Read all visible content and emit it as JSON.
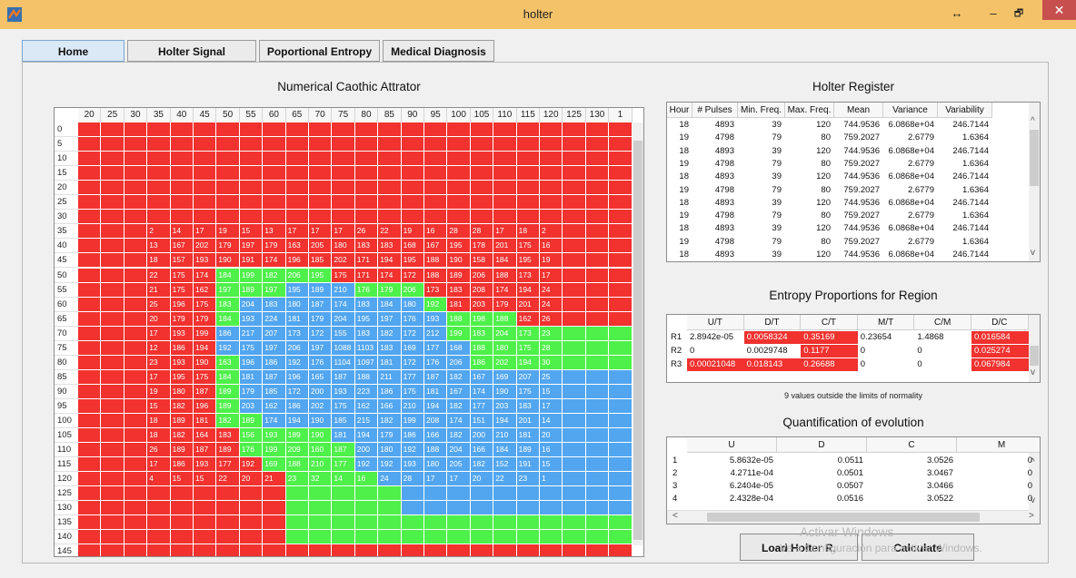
{
  "window": {
    "title": "holter",
    "buttons": {
      "restore": "↔",
      "minimize": "–",
      "maximize": "🗗",
      "close": "✕"
    },
    "accent": "#f3c269"
  },
  "tabs": [
    {
      "label": "Home",
      "active": true
    },
    {
      "label": "Holter Signal",
      "active": false
    },
    {
      "label": "Poportional Entropy",
      "active": false
    },
    {
      "label": "Medical Diagnosis",
      "active": false
    }
  ],
  "attractor": {
    "title": "Numerical Caothic Attrator",
    "columns": [
      "20",
      "25",
      "30",
      "35",
      "40",
      "45",
      "50",
      "55",
      "60",
      "65",
      "70",
      "75",
      "80",
      "85",
      "90",
      "95",
      "100",
      "105",
      "110",
      "115",
      "120",
      "125",
      "130",
      "1"
    ],
    "rows": [
      "0",
      "5",
      "10",
      "15",
      "20",
      "25",
      "30",
      "35",
      "40",
      "45",
      "50",
      "55",
      "60",
      "65",
      "70",
      "75",
      "80",
      "85",
      "90",
      "95",
      "100",
      "105",
      "110",
      "115",
      "120",
      "125",
      "130",
      "135",
      "140",
      "145"
    ],
    "color_codes": {
      "R": "#f1322f",
      "G": "#4ef04a",
      "B": "#52a6ef"
    },
    "row_colors": [
      "RRRRRRRRRRRRRRRRRRRRRRRR",
      "RRRRRRRRRRRRRRRRRRRRRRRR",
      "RRRRRRRRRRRRRRRRRRRRRRRR",
      "RRRRRRRRRRRRRRRRRRRRRRRR",
      "RRRRRRRRRRRRRRRRRRRRRRRR",
      "RRRRRRRRRRRRRRRRRRRRRRRR",
      "RRRRRRRRRRRRRRRRRRRRRRRR",
      "RRRRRRRRRRRRRRRRRRRRRRRR",
      "RRRRRRRRRRRRRRRRRRRRRRRR",
      "RRRRRRRRRRRRRRRRRRRRRRRR",
      "RRRRRRGGGGGRRRRRRRRRRRRR",
      "RRRRRRGGGBBBGGGRRRRRRRRR",
      "RRRRRRGBBBBBBBBGRRRRRRRR",
      "RRRRRRGBBBBBBBBBGGGRRRRR",
      "RRRRRRBBBBBBBBBBGGGGGGGG",
      "RRRRRRBBBBBBBBBBBGGGGGGG",
      "RRRRRRGBBBBBBBBBBGGGGGGG",
      "RRRRRRGBBBBBBBBBBBBBBBBB",
      "RRRRRRGBBBBBBBBBBBBBBBBB",
      "RRRRRRGBBBBBBBBBBBBBBBBB",
      "RRRRRRGGBBBBBBBBBBBBBBBB",
      "RRRRRRRGGGGBBBBBBBBBBBBB",
      "RRRRRRRGGGGGBBBBBBBBBBBB",
      "RRRRRRRRGGGGBBBBBBBBBBBB",
      "RRRRRRRRRGGGGBBBBBBBBBBB",
      "RRRRRRRRRGGGGGBBBBBBBBBB",
      "RRRRRRRRRGGGGGBBBBBBBBBB",
      "RRRRRRRRRGGGGGGGGGGGGGGG",
      "RRRRRRRRRGGGGGGGGGGGGGGG",
      "RRRRRRRRRRRRRRRRRRRRRRRR"
    ],
    "values": {
      "7": [
        "",
        "",
        "",
        "2",
        "14",
        "17",
        "19",
        "15",
        "13",
        "17",
        "17",
        "17",
        "26",
        "22",
        "19",
        "16",
        "28",
        "28",
        "17",
        "18",
        "2",
        "",
        "",
        ""
      ],
      "8": [
        "",
        "",
        "",
        "13",
        "167",
        "202",
        "179",
        "197",
        "179",
        "163",
        "205",
        "180",
        "183",
        "183",
        "168",
        "167",
        "195",
        "178",
        "201",
        "175",
        "16",
        "",
        "",
        ""
      ],
      "9": [
        "",
        "",
        "",
        "18",
        "157",
        "193",
        "190",
        "191",
        "174",
        "196",
        "185",
        "202",
        "171",
        "194",
        "195",
        "188",
        "190",
        "158",
        "184",
        "195",
        "19",
        "",
        "",
        ""
      ],
      "10": [
        "",
        "",
        "",
        "22",
        "175",
        "174",
        "184",
        "199",
        "182",
        "206",
        "195",
        "175",
        "171",
        "174",
        "172",
        "188",
        "189",
        "206",
        "188",
        "173",
        "17",
        "",
        "",
        ""
      ],
      "11": [
        "",
        "",
        "",
        "21",
        "175",
        "162",
        "197",
        "189",
        "197",
        "195",
        "189",
        "210",
        "176",
        "179",
        "206",
        "173",
        "183",
        "208",
        "174",
        "194",
        "24",
        "",
        "",
        ""
      ],
      "12": [
        "",
        "",
        "",
        "25",
        "196",
        "175",
        "183",
        "204",
        "183",
        "180",
        "187",
        "174",
        "183",
        "184",
        "180",
        "192",
        "181",
        "203",
        "179",
        "201",
        "24",
        "",
        "",
        ""
      ],
      "13": [
        "",
        "",
        "",
        "20",
        "179",
        "179",
        "184",
        "193",
        "224",
        "181",
        "179",
        "204",
        "195",
        "197",
        "176",
        "193",
        "188",
        "198",
        "188",
        "162",
        "26",
        "",
        "",
        ""
      ],
      "14": [
        "",
        "",
        "",
        "17",
        "193",
        "199",
        "186",
        "217",
        "207",
        "173",
        "172",
        "155",
        "183",
        "182",
        "172",
        "212",
        "199",
        "183",
        "204",
        "173",
        "23",
        "",
        "",
        ""
      ],
      "15": [
        "",
        "",
        "",
        "12",
        "186",
        "194",
        "192",
        "175",
        "197",
        "206",
        "197",
        "1088",
        "1103",
        "183",
        "169",
        "177",
        "168",
        "188",
        "180",
        "175",
        "28",
        "",
        "",
        ""
      ],
      "16": [
        "",
        "",
        "",
        "23",
        "193",
        "190",
        "163",
        "196",
        "186",
        "192",
        "176",
        "1104",
        "1097",
        "181",
        "172",
        "176",
        "206",
        "186",
        "202",
        "194",
        "30",
        "",
        "",
        ""
      ],
      "17": [
        "",
        "",
        "",
        "17",
        "195",
        "175",
        "184",
        "181",
        "187",
        "196",
        "165",
        "187",
        "188",
        "211",
        "177",
        "187",
        "182",
        "167",
        "169",
        "207",
        "25",
        "",
        "",
        ""
      ],
      "18": [
        "",
        "",
        "",
        "19",
        "180",
        "187",
        "189",
        "179",
        "185",
        "172",
        "200",
        "193",
        "223",
        "186",
        "175",
        "181",
        "167",
        "174",
        "190",
        "175",
        "15",
        "",
        "",
        ""
      ],
      "19": [
        "",
        "",
        "",
        "15",
        "182",
        "196",
        "189",
        "203",
        "162",
        "186",
        "202",
        "175",
        "162",
        "166",
        "210",
        "194",
        "182",
        "177",
        "203",
        "183",
        "17",
        "",
        "",
        ""
      ],
      "20": [
        "",
        "",
        "",
        "18",
        "189",
        "181",
        "182",
        "189",
        "174",
        "194",
        "190",
        "185",
        "215",
        "182",
        "199",
        "208",
        "174",
        "151",
        "194",
        "201",
        "14",
        "",
        "",
        ""
      ],
      "21": [
        "",
        "",
        "",
        "18",
        "182",
        "164",
        "183",
        "156",
        "193",
        "189",
        "190",
        "181",
        "194",
        "179",
        "186",
        "166",
        "182",
        "200",
        "210",
        "181",
        "20",
        "",
        "",
        ""
      ],
      "22": [
        "",
        "",
        "",
        "26",
        "189",
        "187",
        "189",
        "176",
        "199",
        "209",
        "160",
        "187",
        "200",
        "180",
        "192",
        "188",
        "204",
        "166",
        "184",
        "189",
        "16",
        "",
        "",
        ""
      ],
      "23": [
        "",
        "",
        "",
        "17",
        "186",
        "193",
        "177",
        "192",
        "169",
        "188",
        "210",
        "177",
        "192",
        "192",
        "193",
        "180",
        "205",
        "182",
        "152",
        "191",
        "15",
        "",
        "",
        ""
      ],
      "24": [
        "",
        "",
        "",
        "4",
        "15",
        "15",
        "22",
        "20",
        "21",
        "23",
        "32",
        "14",
        "16",
        "24",
        "28",
        "17",
        "17",
        "20",
        "22",
        "23",
        "1",
        "",
        "",
        ""
      ]
    }
  },
  "holter_register": {
    "title": "Holter Register",
    "headers": [
      "Hour",
      "# Pulses",
      "Min. Freq.",
      "Max. Freq.",
      "Mean",
      "Variance",
      "Variability"
    ],
    "rows": [
      [
        "18",
        "4893",
        "39",
        "120",
        "744.9536",
        "6.0868e+04",
        "246.7144"
      ],
      [
        "19",
        "4798",
        "79",
        "80",
        "759.2027",
        "2.6779",
        "1.6364"
      ],
      [
        "18",
        "4893",
        "39",
        "120",
        "744.9536",
        "6.0868e+04",
        "246.7144"
      ],
      [
        "19",
        "4798",
        "79",
        "80",
        "759.2027",
        "2.6779",
        "1.6364"
      ],
      [
        "18",
        "4893",
        "39",
        "120",
        "744.9536",
        "6.0868e+04",
        "246.7144"
      ],
      [
        "19",
        "4798",
        "79",
        "80",
        "759.2027",
        "2.6779",
        "1.6364"
      ],
      [
        "18",
        "4893",
        "39",
        "120",
        "744.9536",
        "6.0868e+04",
        "246.7144"
      ],
      [
        "19",
        "4798",
        "79",
        "80",
        "759.2027",
        "2.6779",
        "1.6364"
      ],
      [
        "18",
        "4893",
        "39",
        "120",
        "744.9536",
        "6.0868e+04",
        "246.7144"
      ],
      [
        "19",
        "4798",
        "79",
        "80",
        "759.2027",
        "2.6779",
        "1.6364"
      ],
      [
        "18",
        "4893",
        "39",
        "120",
        "744.9536",
        "6.0868e+04",
        "246.7144"
      ]
    ]
  },
  "entropy": {
    "title": "Entropy Proportions for Region",
    "headers": [
      "U/T",
      "D/T",
      "C/T",
      "M/T",
      "C/M",
      "D/C"
    ],
    "row_labels": [
      "R1",
      "R2",
      "R3"
    ],
    "rows": [
      [
        "2.8942e-05",
        "0.0058324",
        "0.35169",
        "0.23654",
        "1.4868",
        "0.016584"
      ],
      [
        "0",
        "0.0029748",
        "0.1177",
        "0",
        "0",
        "0.025274"
      ],
      [
        "0.00021048",
        "0.018143",
        "0.26688",
        "0",
        "0",
        "0.067984"
      ]
    ],
    "highlight": [
      [
        false,
        true,
        true,
        false,
        false,
        true
      ],
      [
        false,
        false,
        true,
        false,
        false,
        true
      ],
      [
        true,
        true,
        true,
        false,
        false,
        true
      ]
    ],
    "highlight_color": "#f1322f",
    "note": "9 values outside the limits of normality"
  },
  "evolution": {
    "title": "Quantification of evolution",
    "headers": [
      "U",
      "D",
      "C",
      "M"
    ],
    "row_labels": [
      "1",
      "2",
      "3",
      "4"
    ],
    "rows": [
      [
        "5.8632e-05",
        "0.0511",
        "3.0526",
        "0"
      ],
      [
        "4.2711e-04",
        "0.0501",
        "3.0467",
        "0"
      ],
      [
        "6.2404e-05",
        "0.0507",
        "3.0466",
        "0"
      ],
      [
        "2.4328e-04",
        "0.0516",
        "3.0522",
        "0"
      ]
    ]
  },
  "buttons": {
    "load": "Load Holter R.",
    "calculate": "Calculate"
  },
  "watermark": {
    "line1": "Activar Windows",
    "line2": "Ve a Configuración para activar Windows."
  }
}
